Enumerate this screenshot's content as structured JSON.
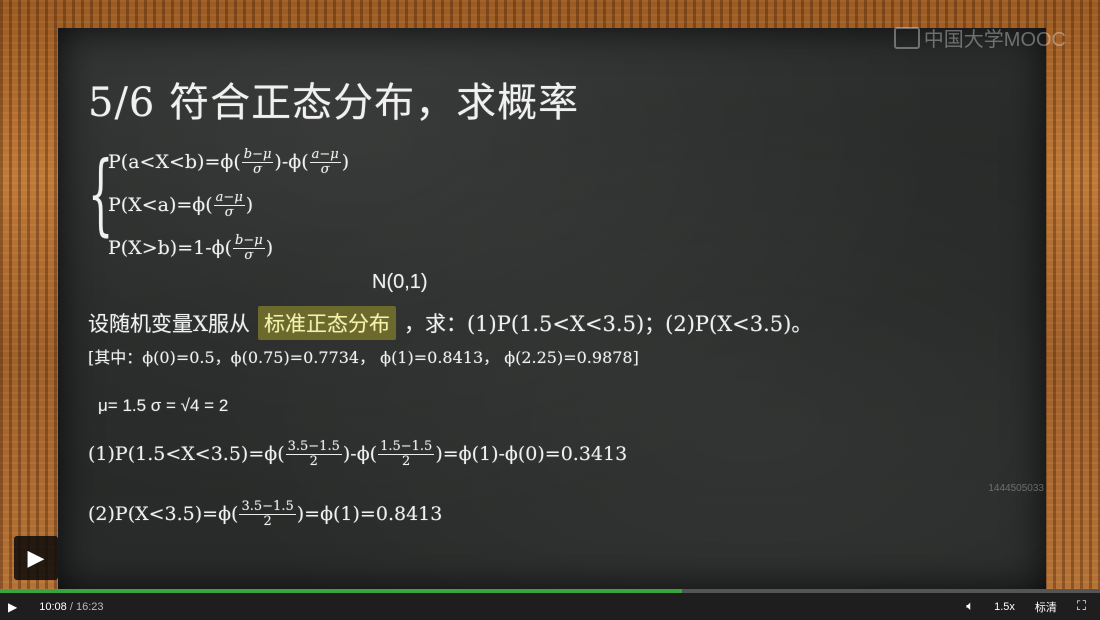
{
  "slide": {
    "title": "5/6 符合正态分布，求概率",
    "logo": "中国大学MOOC",
    "formulas": {
      "f1_left": "P(a<X<b)=ϕ(",
      "f1_n1": "b−μ",
      "f1_d1": "σ",
      "f1_mid": ")-ϕ(",
      "f1_n2": "a−μ",
      "f1_d2": "σ",
      "f1_end": ")",
      "f2_left": "P(X<a)=ϕ(",
      "f2_n": "a−μ",
      "f2_d": "σ",
      "f2_end": ")",
      "f3_left": "P(X>b)=1-ϕ(",
      "f3_n": "b−μ",
      "f3_d": "σ",
      "f3_end": ")"
    },
    "annotation": "N(0,1)",
    "question_pre": "设随机变量X服从",
    "question_highlight": "标准正态分布",
    "question_post": "，求：(1)P(1.5<X<3.5)；(2)P(X<3.5)。",
    "hint": "[其中：ϕ(0)=0.5，ϕ(0.75)=0.7734， ϕ(1)=0.8413， ϕ(2.25)=0.9878]",
    "params": "μ= 1.5   σ = √4 = 2",
    "sol1": {
      "left": "(1)P(1.5<X<3.5)=ϕ(",
      "n1": "3.5−1.5",
      "d1": "2",
      "mid": ")-ϕ(",
      "n2": "1.5−1.5",
      "d2": "2",
      "end": ")=ϕ(1)-ϕ(0)=0.3413"
    },
    "sol2": {
      "left": "(2)P(X<3.5)=ϕ(",
      "n": "3.5−1.5",
      "d": "2",
      "end": ")=ϕ(1)=0.8413"
    },
    "watermark": "1444505033"
  },
  "player": {
    "current_time": "10:08",
    "separator": "/",
    "total_time": "16:23",
    "progress": 0.62,
    "speed": "1.5x",
    "quality": "标清",
    "icons": {
      "play": "play-icon",
      "volume": "volume-icon",
      "fullscreen": "fullscreen-icon"
    }
  }
}
